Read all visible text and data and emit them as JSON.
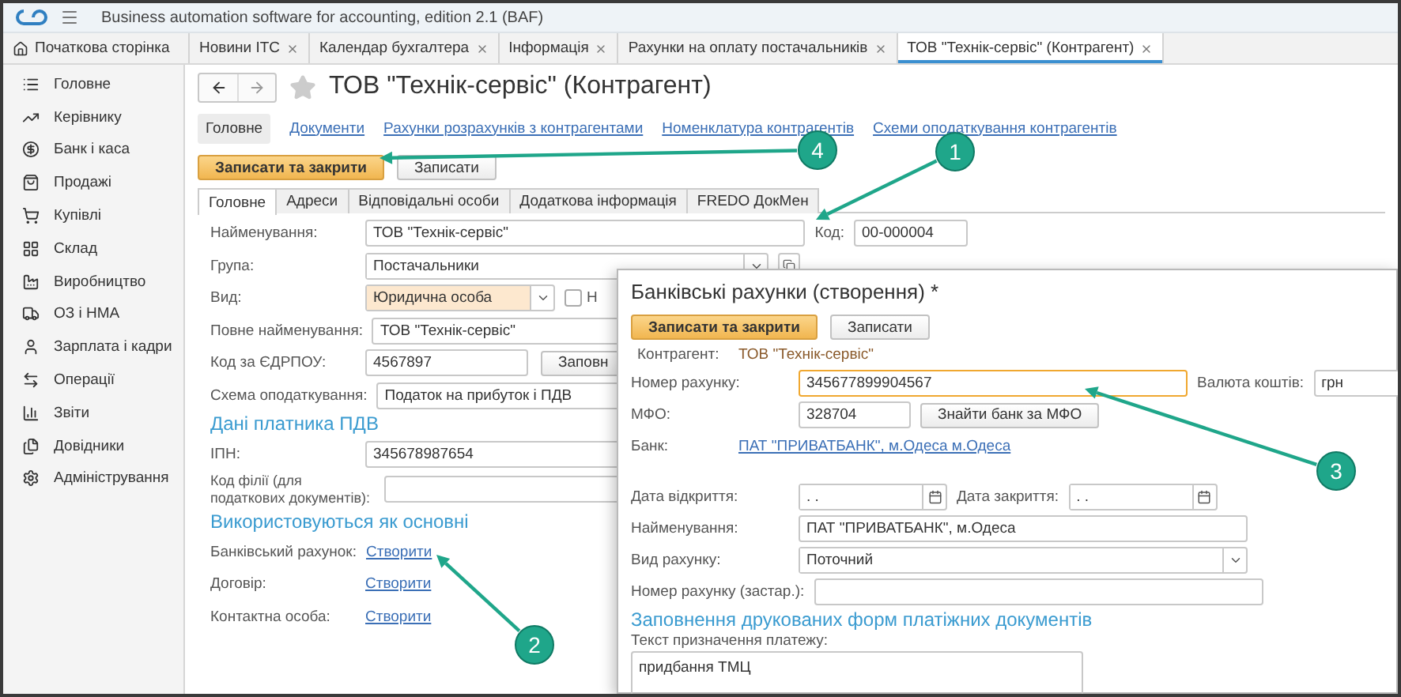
{
  "app_title": "Business automation software for accounting, edition 2.1  (BAF)",
  "home_tab": {
    "label": "Початкова сторінка"
  },
  "tabs": [
    {
      "label": "Новини ІТС",
      "selected": false
    },
    {
      "label": "Календар бухгалтера",
      "selected": false
    },
    {
      "label": "Інформація",
      "selected": false
    },
    {
      "label": "Рахунки на оплату постачальників",
      "selected": false
    },
    {
      "label": "ТОВ \"Технік-сервіс\" (Контрагент)",
      "selected": true
    }
  ],
  "sidebar": {
    "items": [
      {
        "label": "Головне"
      },
      {
        "label": "Керівнику"
      },
      {
        "label": "Банк і каса"
      },
      {
        "label": "Продажі"
      },
      {
        "label": "Купівлі"
      },
      {
        "label": "Склад"
      },
      {
        "label": "Виробництво"
      },
      {
        "label": "ОЗ і НМА"
      },
      {
        "label": "Зарплата і кадри"
      },
      {
        "label": "Операції"
      },
      {
        "label": "Звіти"
      },
      {
        "label": "Довідники"
      },
      {
        "label": "Адміністрування"
      }
    ]
  },
  "form": {
    "title": "ТОВ \"Технік-сервіс\" (Контрагент)",
    "nav": [
      {
        "label": "Головне",
        "selected": true
      },
      {
        "label": "Документи",
        "selected": false
      },
      {
        "label": "Рахунки розрахунків з контрагентами",
        "selected": false
      },
      {
        "label": "Номенклатура контрагентів",
        "selected": false
      },
      {
        "label": "Схеми оподаткування контрагентів",
        "selected": false
      }
    ],
    "buttons": [
      {
        "label": "Записати та закрити",
        "kind": "primary"
      },
      {
        "label": "Записати",
        "kind": "default"
      }
    ],
    "tabs": [
      {
        "label": "Головне",
        "selected": true
      },
      {
        "label": "Адреси",
        "selected": false
      },
      {
        "label": "Відповідальні особи",
        "selected": false
      },
      {
        "label": "Додаткова інформація",
        "selected": false
      },
      {
        "label": "FREDO ДокМен",
        "selected": false
      }
    ],
    "rows": [
      {
        "kind": "field",
        "label": "Найменування:",
        "value": "ТОВ \"Технік-сервіс\"",
        "side_label": "Код:",
        "side_value": "00-000004"
      },
      {
        "kind": "select",
        "label": "Група:",
        "value": "Постачальники",
        "highlighted": false
      },
      {
        "kind": "select",
        "label": "Вид:",
        "value": "Юридична особа",
        "highlighted": true,
        "checkbox": {
          "checked": false,
          "label": "Н"
        }
      },
      {
        "kind": "field",
        "label": "Повне найменування:",
        "value": "ТОВ \"Технік-сервіс\""
      },
      {
        "kind": "field",
        "label": "Код за ЄДРПОУ:",
        "value": "4567897",
        "button": "Заповн"
      },
      {
        "kind": "field",
        "label": "Схема оподаткування:",
        "value": "Податок на прибуток і ПДВ"
      },
      {
        "kind": "heading",
        "label": "Дані платника ПДВ"
      },
      {
        "kind": "field",
        "label": "ІПН:",
        "value": "345678987654"
      },
      {
        "kind": "field",
        "label": "Код філії (для податкових документів):"
      },
      {
        "kind": "heading",
        "label": "Використовуються як основні"
      },
      {
        "kind": "link",
        "label": "Банківський рахунок:",
        "value": "Створити"
      },
      {
        "kind": "link",
        "label": "Договір:",
        "value": "Створити"
      },
      {
        "kind": "link",
        "label": "Контактна особа:",
        "value": "Створити"
      }
    ]
  },
  "dialog": {
    "title": "Банківські рахунки (створення) *",
    "buttons": [
      {
        "label": "Записати та закрити",
        "kind": "primary"
      },
      {
        "label": "Записати",
        "kind": "default"
      }
    ],
    "rows": [
      {
        "kind": "info",
        "label": "Контрагент:",
        "value": "ТОВ \"Технік-сервіс\""
      },
      {
        "kind": "field",
        "label": "Номер рахунку:",
        "value": "345677899904567",
        "focused": true,
        "side_label": "Валюта коштів:",
        "side_value": "грн"
      },
      {
        "kind": "field",
        "label": "МФО:",
        "value": "328704",
        "focused": false,
        "button": "Знайти банк за МФО"
      },
      {
        "kind": "link",
        "label": "Банк:",
        "value": "ПАТ \"ПРИВАТБАНК\", м.Одеса м.Одеса"
      },
      {
        "kind": "date",
        "label": "Дата відкриття:",
        "value": ". .",
        "side_label": "Дата закриття:",
        "side_value": ". ."
      },
      {
        "kind": "field",
        "label": "Найменування:",
        "value": "ПАТ \"ПРИВАТБАНК\", м.Одеса",
        "focused": false
      },
      {
        "kind": "select",
        "label": "Вид рахунку:",
        "value": "Поточний"
      },
      {
        "kind": "field",
        "label": "Номер рахунку (застар.):",
        "focused": false
      },
      {
        "kind": "heading",
        "label": "Заповнення друкованих форм платіжних документів"
      },
      {
        "kind": "caption",
        "label": "Текст призначення платежу:"
      },
      {
        "kind": "textarea",
        "value": "придбання ТМЦ"
      }
    ]
  },
  "annotations": [
    {
      "number": "1"
    },
    {
      "number": "2"
    },
    {
      "number": "3"
    },
    {
      "number": "4"
    }
  ]
}
